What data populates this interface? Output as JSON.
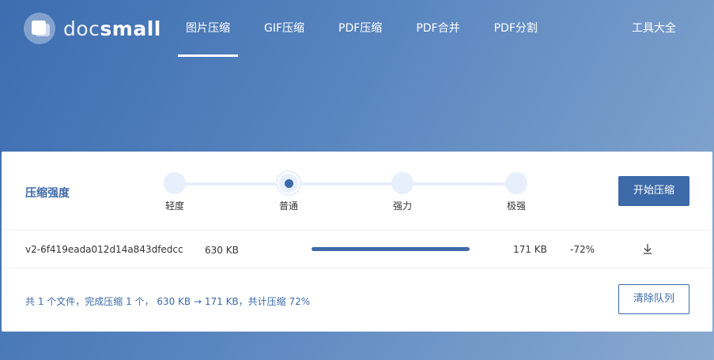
{
  "logo": {
    "text_light": "doc",
    "text_bold": "small"
  },
  "nav": {
    "items": [
      {
        "label": "图片压缩",
        "active": true
      },
      {
        "label": "GIF压缩",
        "active": false
      },
      {
        "label": "PDF压缩",
        "active": false
      },
      {
        "label": "PDF合并",
        "active": false
      },
      {
        "label": "PDF分割",
        "active": false
      }
    ],
    "tools_label": "工具大全"
  },
  "compression": {
    "label": "压缩强度",
    "levels": [
      "轻度",
      "普通",
      "强力",
      "极强"
    ],
    "selected_index": 1,
    "start_button": "开始压缩"
  },
  "files": [
    {
      "name": "v2-6f419eada012d14a843dfedcc3...",
      "original_size": "630 KB",
      "progress": 1.0,
      "compressed_size": "171 KB",
      "ratio": "-72%"
    }
  ],
  "summary": {
    "text": "共 1 个文件，完成压缩 1 个， 630 KB → 171 KB，共计压缩 72%",
    "clear_button": "清除队列"
  },
  "colors": {
    "accent": "#3d6aa8",
    "track": "#e6eefc"
  }
}
